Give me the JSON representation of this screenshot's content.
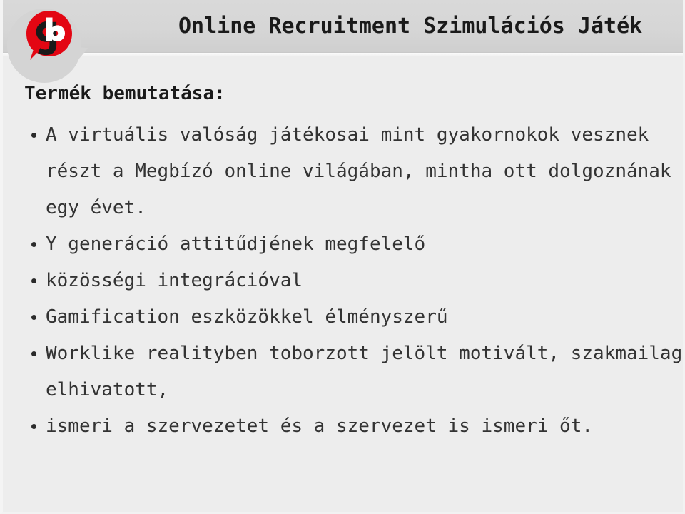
{
  "header": {
    "title": "Online Recruitment Szimulációs Játék",
    "logo_alt": "gb logo",
    "band_color": "#d6d6d6",
    "title_color": "#1a1a1a",
    "logo_red": "#e30613"
  },
  "body": {
    "background_color": "#ededed",
    "text_color": "#333333",
    "heading": "Termék bemutatása:",
    "bullets": [
      {
        "text": "A virtuális valóság játékosai mint gyakornokok vesznek részt a Megbízó online világában, mintha ott dolgoznának egy évet."
      },
      {
        "text": "Y generáció attitűdjének megfelelő"
      },
      {
        "text": "közösségi integrációval"
      },
      {
        "text": "Gamification eszközökkel élményszerű"
      },
      {
        "text": "Worklike realityben toborzott jelölt motivált, szakmailag elhivatott,"
      },
      {
        "text": "ismeri a szervezetet és a szervezet is ismeri őt."
      }
    ]
  }
}
